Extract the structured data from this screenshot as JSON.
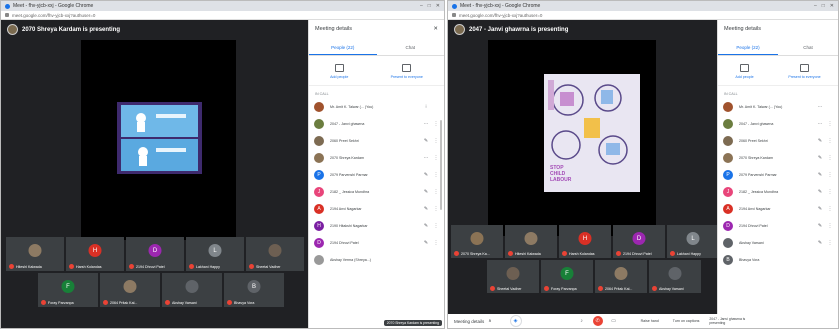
{
  "left": {
    "browser_title": "Meet - fhv-yjcb-xxj - Google Chrome",
    "url": "meet.google.com/fhv-yjcb-xxj?authuser=0",
    "presenter_banner": "2070 Shreya Kardam is presenting",
    "panel": {
      "title": "Meeting details",
      "close": "✕",
      "tab_people": "People (22)",
      "tab_chat": "Chat",
      "add_people": "Add people",
      "present": "Present to everyone",
      "list_header": "IN CALL",
      "participants": [
        {
          "name": "Mr. Amit K. Talwar (... (You)",
          "initial": "",
          "color": "#a0522d",
          "mic": "⁝",
          "menu": ""
        },
        {
          "name": "2047 - Janvi ghawrna",
          "initial": "",
          "color": "#6b7d3f",
          "mic": "···",
          "menu": "⋮"
        },
        {
          "name": "2060 Preet Sekhri",
          "initial": "",
          "color": "#7d6b52",
          "mic": "✎",
          "menu": "⋮"
        },
        {
          "name": "2070 Shreya Kardam",
          "initial": "",
          "color": "#8b7355",
          "mic": "···",
          "menu": "⋮"
        },
        {
          "name": "2079 Parvenshi Parmar",
          "initial": "P",
          "color": "#1a73e8",
          "mic": "✎",
          "menu": "⋮"
        },
        {
          "name": "2182 _ Jessica Mundhra",
          "initial": "J",
          "color": "#e8457a",
          "mic": "✎",
          "menu": "⋮"
        },
        {
          "name": "2194 Anvi Nagarkar",
          "initial": "A",
          "color": "#d93025",
          "mic": "✎",
          "menu": "⋮"
        },
        {
          "name": "2190 Hitakshi Nagarkar",
          "initial": "H",
          "color": "#7b1fa2",
          "mic": "✎",
          "menu": "⋮"
        },
        {
          "name": "2194 Dhruvi Patel",
          "initial": "D",
          "color": "#9c27b0",
          "mic": "✎",
          "menu": "⋮"
        },
        {
          "name": "Akshay Verma (Shreya...)",
          "initial": "",
          "color": "#999",
          "mic": "",
          "menu": ""
        }
      ],
      "tooltip": "2070 Shreya Kardam is presenting"
    },
    "tiles_row1": [
      {
        "name": "Hiteshi Kalwada",
        "initial": "",
        "color": "#8d7a63"
      },
      {
        "name": "Harsh Kolandas",
        "initial": "H",
        "color": "#d93025"
      },
      {
        "name": "2194 Dhruvi Patel",
        "initial": "D",
        "color": "#9c27b0"
      },
      {
        "name": "Lakhani Happy",
        "initial": "L",
        "color": "#80868b"
      },
      {
        "name": "Sheetal Vadher",
        "initial": "",
        "color": "#6d5f52"
      }
    ],
    "tiles_row2": [
      {
        "name": "Foray Parvanpa",
        "initial": "F",
        "color": "#188038"
      },
      {
        "name": "2064 Pritak Kal...",
        "initial": "",
        "color": "#8d7a63"
      },
      {
        "name": "Akshay Varsani",
        "initial": "",
        "color": "#5f6368"
      },
      {
        "name": "Bhavya Vora",
        "initial": "B",
        "color": "#5f6368"
      }
    ]
  },
  "right": {
    "browser_title": "Meet - fhv-yjcb-xxj - Google Chrome",
    "url": "meet.google.com/fhv-yjcb-xxj?authuser=0",
    "presenter_banner": "2047 - Janvi ghawrna is presenting",
    "slide_text": "STOP CHILD LABOUR",
    "panel": {
      "title": "Meeting details",
      "tab_people": "People (22)",
      "tab_chat": "Chat",
      "add_people": "Add people",
      "present": "Present to everyone",
      "list_header": "IN CALL",
      "participants": [
        {
          "name": "Mr. Amit K. Talwar (... (You)",
          "initial": "",
          "color": "#a0522d",
          "mic": "···",
          "menu": ""
        },
        {
          "name": "2047 - Janvi ghawrna",
          "initial": "",
          "color": "#6b7d3f",
          "mic": "···",
          "menu": "⋮"
        },
        {
          "name": "2060 Preet Sekhri",
          "initial": "",
          "color": "#7d6b52",
          "mic": "✎",
          "menu": "⋮"
        },
        {
          "name": "2070 Shreya Kardam",
          "initial": "",
          "color": "#8b7355",
          "mic": "✎",
          "menu": "⋮"
        },
        {
          "name": "2079 Parvenshi Parmar",
          "initial": "P",
          "color": "#1a73e8",
          "mic": "✎",
          "menu": "⋮"
        },
        {
          "name": "2182 _ Jessica Mundhra",
          "initial": "J",
          "color": "#e8457a",
          "mic": "✎",
          "menu": "⋮"
        },
        {
          "name": "2194 Anvi Nagarkar",
          "initial": "A",
          "color": "#d93025",
          "mic": "✎",
          "menu": "⋮"
        },
        {
          "name": "2194 Dhruvi Patel",
          "initial": "D",
          "color": "#9c27b0",
          "mic": "✎",
          "menu": "⋮"
        },
        {
          "name": "Akshay Varsani",
          "initial": "",
          "color": "#5f6368",
          "mic": "✎",
          "menu": "⋮"
        },
        {
          "name": "Bhavya Vora",
          "initial": "B",
          "color": "#5f6368",
          "mic": "",
          "menu": ""
        }
      ]
    },
    "tiles_row1": [
      {
        "name": "2070 Shreya Ka...",
        "initial": "",
        "color": "#8b7355"
      },
      {
        "name": "Hiteshi Kalwada",
        "initial": "",
        "color": "#8d7a63"
      },
      {
        "name": "Harsh Kolandas",
        "initial": "H",
        "color": "#d93025"
      },
      {
        "name": "2194 Dhruvi Patel",
        "initial": "D",
        "color": "#9c27b0"
      },
      {
        "name": "Lakhani Happy",
        "initial": "L",
        "color": "#80868b"
      }
    ],
    "tiles_row2": [
      {
        "name": "Sheetal Vadher",
        "initial": "",
        "color": "#6d5f52"
      },
      {
        "name": "Foray Parvanpa",
        "initial": "F",
        "color": "#188038"
      },
      {
        "name": "2064 Pritak Kal...",
        "initial": "",
        "color": "#8d7a63"
      },
      {
        "name": "Akshay Varsani",
        "initial": "",
        "color": "#5f6368"
      }
    ],
    "bottom": {
      "meeting_details": "Meeting details",
      "chevron": "∧",
      "raise_hand": "Raise hand",
      "turn_on_captions": "Turn on captions",
      "presenting": "2047 - Janvi ghawrna is presenting"
    }
  }
}
